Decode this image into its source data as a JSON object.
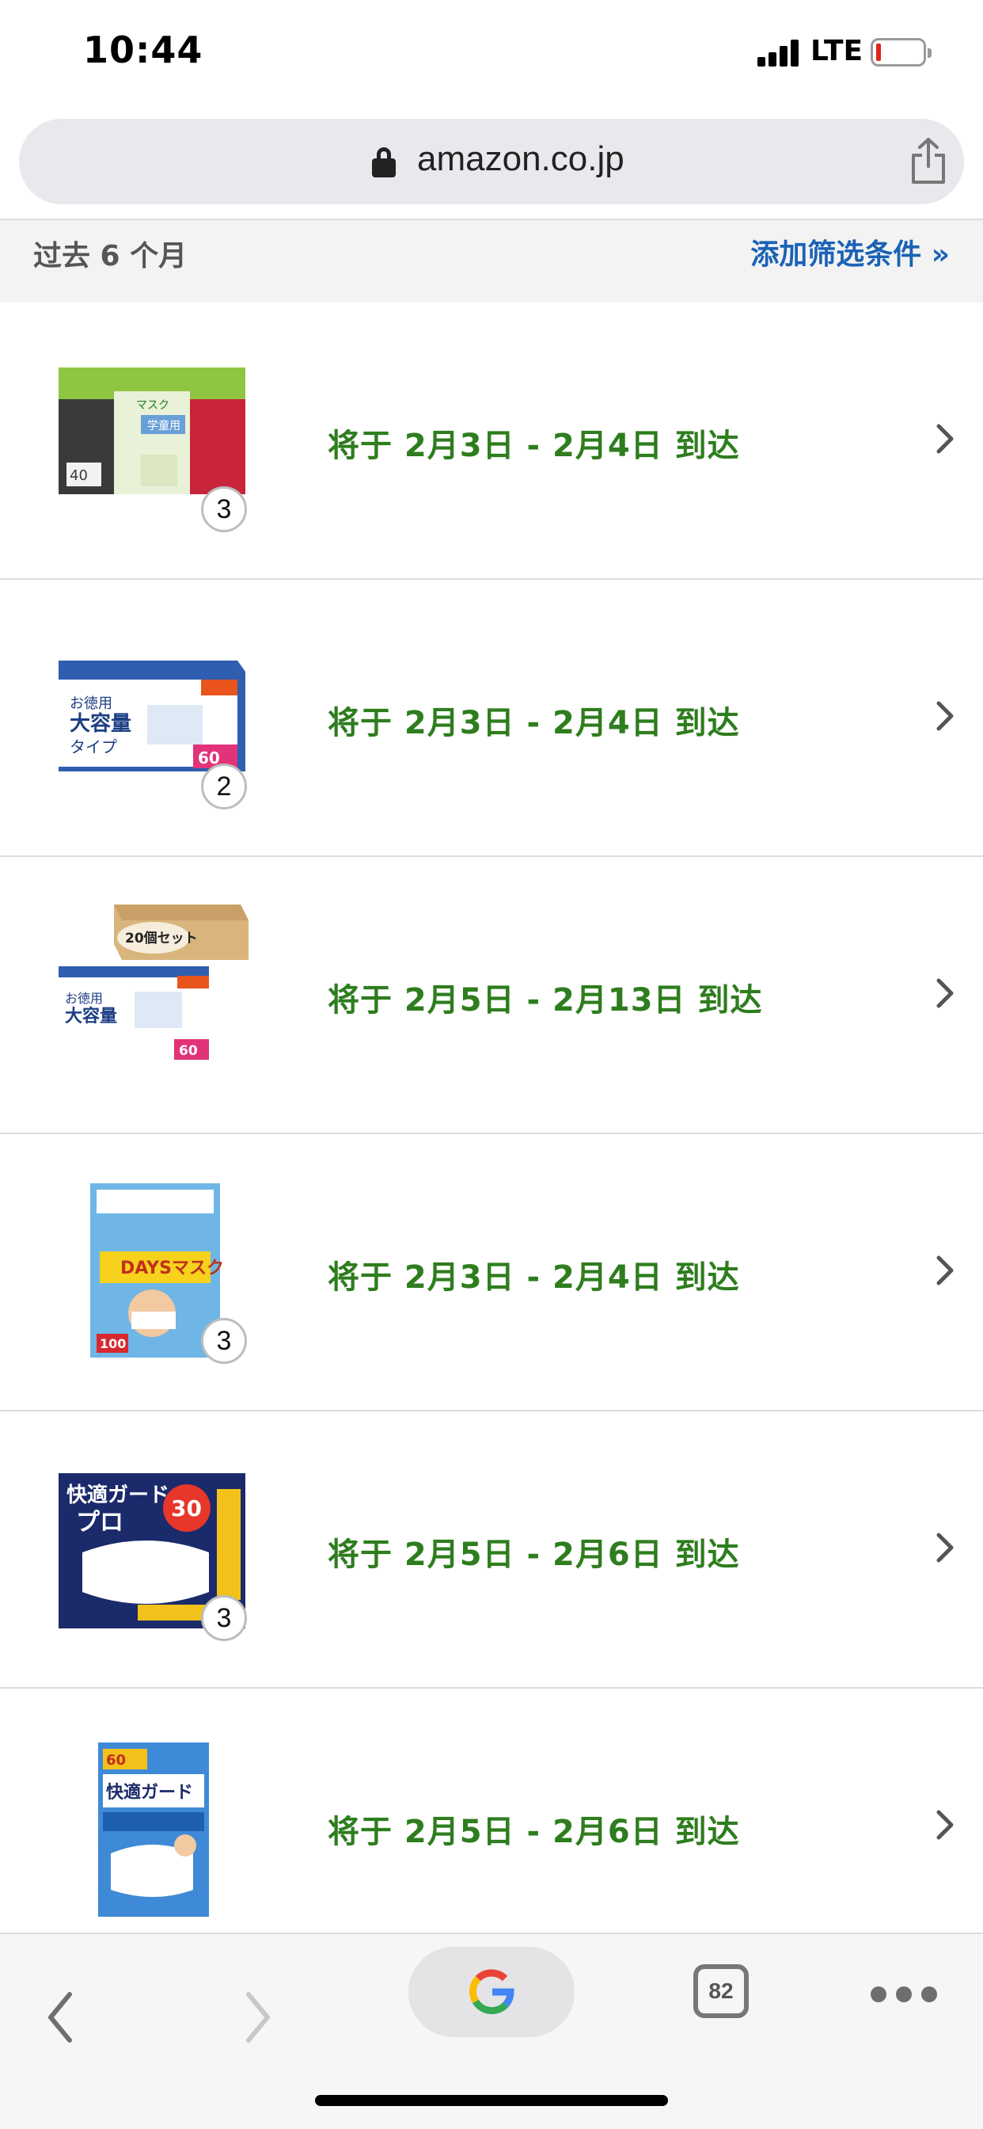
{
  "status_bar": {
    "time": "10:44",
    "network": "LTE"
  },
  "browser": {
    "url": "amazon.co.jp"
  },
  "filter": {
    "period": "过去 6 个月",
    "add_filter": "添加筛选条件 »"
  },
  "orders": [
    {
      "delivery": "将于 2月3日 - 2月4日 到达",
      "quantity": "3",
      "thumb_label": "マスク"
    },
    {
      "delivery": "将于 2月3日 - 2月4日 到达",
      "quantity": "2",
      "thumb_label": "大容量"
    },
    {
      "delivery": "将于 2月5日 - 2月13日 到达",
      "quantity": null,
      "thumb_label": "20個セット"
    },
    {
      "delivery": "将于 2月3日 - 2月4日 到达",
      "quantity": "3",
      "thumb_label": "DAYSマスク"
    },
    {
      "delivery": "将于 2月5日 - 2月6日 到达",
      "quantity": "3",
      "thumb_label": "快適ガード"
    },
    {
      "delivery": "将于 2月5日 - 2月6日 到达",
      "quantity": null,
      "thumb_label": "快適ガード"
    }
  ],
  "toolbar": {
    "tab_count": "82"
  },
  "colors": {
    "delivery_green": "#2e7d1e",
    "link_blue": "#1a63b4",
    "battery_red": "#e0241b"
  }
}
